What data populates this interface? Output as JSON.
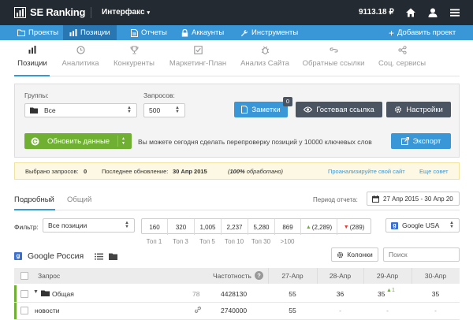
{
  "topbar": {
    "logo_text": "SE Ranking",
    "project": "Интерфакс",
    "balance": "9113.18 ₽"
  },
  "nav": {
    "items": [
      {
        "label": "Проекты",
        "icon": "folder-icon"
      },
      {
        "label": "Позиции",
        "icon": "bar-chart-icon"
      },
      {
        "label": "Отчеты",
        "icon": "document-icon"
      },
      {
        "label": "Аккаунты",
        "icon": "lock-icon"
      },
      {
        "label": "Инструменты",
        "icon": "wrench-icon"
      }
    ],
    "add_project": "Добавить проект",
    "active_index": 1
  },
  "subtabs": [
    {
      "label": "Позиции",
      "icon": "bar-chart-icon"
    },
    {
      "label": "Аналитика",
      "icon": "clock-icon"
    },
    {
      "label": "Конкуренты",
      "icon": "trophy-icon"
    },
    {
      "label": "Маркетинг-План",
      "icon": "checkbox-icon"
    },
    {
      "label": "Анализ Сайта",
      "icon": "bug-icon"
    },
    {
      "label": "Обратные ссылки",
      "icon": "link-icon"
    },
    {
      "label": "Соц. сервисы",
      "icon": "share-icon"
    }
  ],
  "panel": {
    "groups_label": "Группы:",
    "groups_value": "Все",
    "queries_label": "Запросов:",
    "queries_value": "500",
    "notes_label": "Заметки",
    "notes_badge": "0",
    "guest_link_label": "Гостевая ссылка",
    "settings_label": "Настройки",
    "refresh_label": "Обновить данные",
    "refresh_info": "Вы можете сегодня сделать перепроверку позиций у 10000 ключевых слов",
    "export_label": "Экспорт"
  },
  "infobar": {
    "selected_label": "Выбрано запросов:",
    "selected_value": "0",
    "last_update_label": "Последнее обновление:",
    "last_update_value": "30 Апр 2015",
    "processed_percent": "100%",
    "processed_label": "обработано",
    "analyze_link": "Проанализируйте свой сайт",
    "more_link": "Еще совет"
  },
  "view_tabs": {
    "detailed": "Подробный",
    "general": "Общий",
    "period_label": "Период отчета:",
    "period_value": "27 Апр 2015 - 30 Апр 20"
  },
  "filter": {
    "label": "Фильтр:",
    "value": "Все позиции",
    "counts": [
      "160",
      "320",
      "1,005",
      "2,237",
      "5,280",
      "869"
    ],
    "captions": [
      "Топ 1",
      "Топ 3",
      "Топ 5",
      "Топ 10",
      "Топ 30",
      ">100"
    ],
    "up_count": "(2,289)",
    "down_count": "(289)",
    "search_engine": "Google USA"
  },
  "section": {
    "title": "Google Россия",
    "columns_button": "Колонки",
    "search_placeholder": "Поиск"
  },
  "table": {
    "headers": {
      "query": "Запрос",
      "frequency": "Частотность",
      "d1": "27-Апр",
      "d2": "28-Апр",
      "d3": "29-Апр",
      "d4": "30-Апр"
    },
    "rows": [
      {
        "name": "Общая",
        "count": "78",
        "frequency": "4428130",
        "d1": "55",
        "d2": "36",
        "d3": "35",
        "d3_change": "1",
        "d4": "35"
      },
      {
        "name": "новости",
        "count": "",
        "frequency": "2740000",
        "d1": "55",
        "d2": "-",
        "d3": "-",
        "d3_change": "",
        "d4": "-"
      }
    ]
  },
  "colors": {
    "topbar": "#232a31",
    "nav": "#3a97d7",
    "nav_active": "#2877b3",
    "green": "#6fb032",
    "dark_button": "#4a5561"
  }
}
